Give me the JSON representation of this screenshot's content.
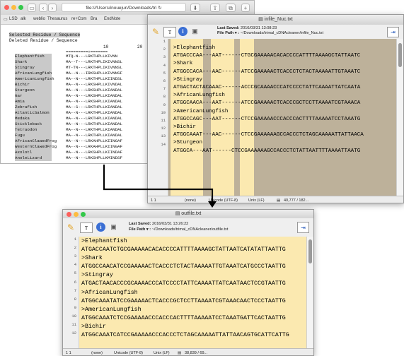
{
  "browser": {
    "url": "file:///Users/inouejun/Downloads/tri",
    "bookmarks": [
      "LSD",
      "alk",
      "weblio",
      "Thesaurus",
      "re+Com",
      "Bra",
      "EndNote"
    ],
    "header_line1": "Selected Residue / Sequence",
    "header_line2": "Deleted Residue / Sequence",
    "col_10": "10",
    "col_20": "20",
    "ruler": "=========+=======",
    "species": [
      "Elephantfish",
      "Shark",
      "Stingray",
      "AfricanLungfish",
      "AmericanLungfish",
      "Bichir",
      "Sturgeon",
      "Gar",
      "Amia",
      "Zebrafish",
      "AtlanticSalmon",
      "Medaka",
      "Stickleback",
      "Tetraodon",
      "Fugu",
      "AfricanClawedFrog",
      "WesternClawedFrog",
      "Axolotl",
      "AnoleLizard"
    ],
    "sequences": [
      "MTQ-N---LRKTHPLLKIVNN",
      "MA--T---LRKTHPLIKIVNNSL",
      "MT-TN---LRKTHPLIKIVNNSL",
      "MA--N---IRKSHPLLKIVNNSF",
      "MA--N---LRKTHPLLKIINDSL",
      "MA--N---LRKSHPLLKIVNDAL",
      "MA--N---LRKSHPLLKIANDAL",
      "MA--N---LRKSHPLLKIANDAL",
      "MA--N---LRKSHPLLKIANDAL",
      "MA--S---LRKTHPLLKIANDAL",
      "MA--N---LRKTHPLLKIANDAL",
      "MA--N---LRKTHPLLKIANDAL",
      "MA--N---LRKTHPLLKIANDAL",
      "MA--N---LRKTHPLLKIANDAL",
      "MA--N---LRKTHPLLKIANDAL",
      "MA--N---LRKAHPLLKIINGAF",
      "MA--N---LRKAHPLLKIINGAF",
      "MA--N---LRKSHPLLKIINDAF",
      "MA--N---LRKSHPLLKMINDSF"
    ]
  },
  "top_editor": {
    "title": "infile_Nuc.txt",
    "last_saved_label": "Last Saved:",
    "last_saved": "2016/03/31 13:08:23",
    "file_path_label": "File Path ▾ :",
    "file_path": "~/Downloads/trimal_cDNAcleaner/infile_Nuc.txt",
    "lines": [
      ">Elephantfish",
      "ATGACCCAA---AAT------CTGCGAAAAACACACCCCATTTTAAAAGCTATTAATC",
      ">Shark",
      "ATGGCCACA---AAC------ATCCGAAAAACTCACCCTCTACTAAAAATTGTAAATC",
      ">Stingray",
      "ATGACTACTACAAAC------ACCCGCAAAACCCATCCCCTATTCAAAATTATCAATA",
      ">AfricanLungfish",
      "ATGGCAACA---AAT------ATCCGAAAAACTCACCCGCTCCTTAAAATCGTAAACA",
      ">AmericanLungfish",
      "ATGGCCAGC---AAT------CTCCGAAAAACCCACCCACTTTTAAAAATCCTAAATG",
      ">Bichir",
      "ATGGCAAAT---AAC------CTCCGAAAAAAGCCACCCTCTAGCAAAAATTATTAACA",
      ">Sturgeon",
      "ATGGCA---AAT------CTCCGAAAAAAGCCACCCTCTATTAATTTTAAAATTAATG"
    ],
    "status": {
      "pos": "1   1",
      "lang": "(none)",
      "enc": "Unicode (UTF-8)",
      "le": "Unix (LF)",
      "stats": "40,777 / 182..."
    }
  },
  "bottom_editor": {
    "title": "outfile.txt",
    "last_saved_label": "Last Saved:",
    "last_saved": "2016/03/31 13:26:22",
    "file_path_label": "File Path ▾ :",
    "file_path": "~/Downloads/trimal_cDNAcleaner/outfile.txt",
    "lines": [
      ">Elephantfish",
      "ATGACCAATCTGCGAAAAACACACCCCATTTTAAAAGCTATTAATCATATATTAATTG",
      ">Shark",
      "ATGGCCAACATCCGAAAAACTCACCCTCTACTAAAAATTGTAAATCATGCCCTAATTG",
      ">Stingray",
      "ATGACTAACACCCGCAAAACCCATCCCCTATTCAAAATTATCAATAACTCCGTAATTG",
      ">AfricanLungfish",
      "ATGGCAAATATCCGAAAAACTCACCCGCTCCTTAAAATCGTAAACAACTCCCTAATTG",
      ">AmericanLungfish",
      "ATGGCAAATCTCCGAAAAACCCACCCACTTTTAAAAATCCTAAATGATTCACTAATTG",
      ">Bichir",
      "ATGGCAAATCATCCGAAAAACCCACCCTCTAGCAAAAATTATTAACAGTGCATTCATTG"
    ],
    "status": {
      "pos": "1   1",
      "lang": "(none)",
      "enc": "Unicode (UTF-8)",
      "le": "Unix (LF)",
      "stats": "38,839 / 69..."
    }
  },
  "icons": {
    "pencil": "pencil-icon",
    "text": "text-options-icon",
    "info": "info-icon",
    "save": "document-save-icon",
    "sidebar": "sidebar-toggle-icon"
  }
}
